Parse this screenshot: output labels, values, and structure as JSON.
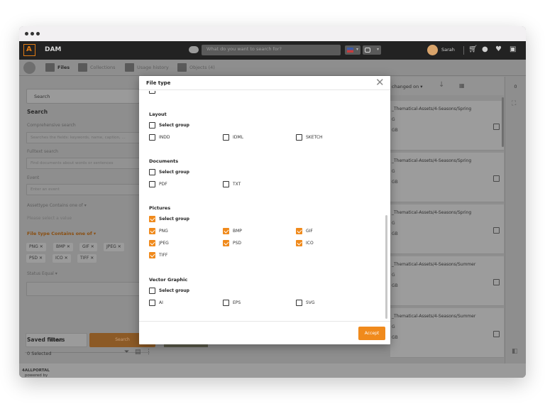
{
  "app": {
    "name": "DAM",
    "search_placeholder": "What do you want to search for?",
    "user_name": "Sarah"
  },
  "tabs": [
    {
      "label": "Files"
    },
    {
      "label": "Collections"
    },
    {
      "label": "Usage history"
    },
    {
      "label": "Objects (4)"
    }
  ],
  "sidebar": {
    "search_label": "Search",
    "search_heading": "Search",
    "comprehensive_label": "Comprehensive search",
    "comprehensive_placeholder": "Searches the fields: keywords, name, caption, ...",
    "fulltext_label": "Fulltext search",
    "fulltext_placeholder": "Find documents about words or sentences",
    "event_label": "Event",
    "event_placeholder": "Enter an event",
    "assettype_label": "Assettype",
    "assettype_operator": "Contains one of",
    "assettype_placeholder": "Please select a value",
    "filetype_label": "File type",
    "filetype_operator": "Contains one of",
    "filetype_chips": [
      "PNG",
      "BMP",
      "GIF",
      "JPEG",
      "PSD",
      "ICO",
      "TIFF"
    ],
    "status_label": "Status",
    "status_operator": "Equal",
    "reset_label": "Reset",
    "search_button_label": "Search",
    "saved_filters_heading": "Saved filters",
    "selected_text": "0 Selected"
  },
  "results": {
    "sort_label": "changed on",
    "count": "0",
    "cards": [
      {
        "path": "_Thematical-Assets/4-Seasons/Spring",
        "line2": "G",
        "line3": "GB"
      },
      {
        "path": "_Thematical-Assets/4-Seasons/Spring",
        "line2": "G",
        "line3": "GB"
      },
      {
        "path": "_Thematical-Assets/4-Seasons/Spring",
        "line2": "G",
        "line3": "GB"
      },
      {
        "path": "_Thematical-Assets/4-Seasons/Summer",
        "line2": "G",
        "line3": "GB"
      },
      {
        "path": "_Thematical-Assets/4-Seasons/Summer",
        "line2": "G",
        "line3": "GB"
      }
    ]
  },
  "footer": {
    "powered_by": "powered by",
    "brand": "4ALLPORTAL"
  },
  "modal": {
    "title": "File type",
    "accept_label": "Accept",
    "groups": {
      "layout": {
        "title": "Layout",
        "select_group": "Select group",
        "options": [
          {
            "label": "INDD",
            "checked": false
          },
          {
            "label": "IDML",
            "checked": false
          },
          {
            "label": "SKETCH",
            "checked": false
          }
        ]
      },
      "documents": {
        "title": "Documents",
        "select_group": "Select group",
        "options": [
          {
            "label": "PDF",
            "checked": false
          },
          {
            "label": "TXT",
            "checked": false
          }
        ]
      },
      "pictures": {
        "title": "Pictures",
        "select_group": "Select group",
        "select_group_checked": true,
        "options": [
          {
            "label": "PNG",
            "checked": true
          },
          {
            "label": "BMP",
            "checked": true
          },
          {
            "label": "GIF",
            "checked": true
          },
          {
            "label": "JPEG",
            "checked": true
          },
          {
            "label": "PSD",
            "checked": true
          },
          {
            "label": "ICO",
            "checked": true
          },
          {
            "label": "TIFF",
            "checked": true
          }
        ]
      },
      "vector": {
        "title": "Vector Graphic",
        "select_group": "Select group",
        "options": [
          {
            "label": "AI",
            "checked": false
          },
          {
            "label": "EPS",
            "checked": false
          },
          {
            "label": "SVG",
            "checked": false
          }
        ]
      }
    }
  },
  "colors": {
    "accent": "#f08a1c",
    "appbar": "#222222"
  }
}
